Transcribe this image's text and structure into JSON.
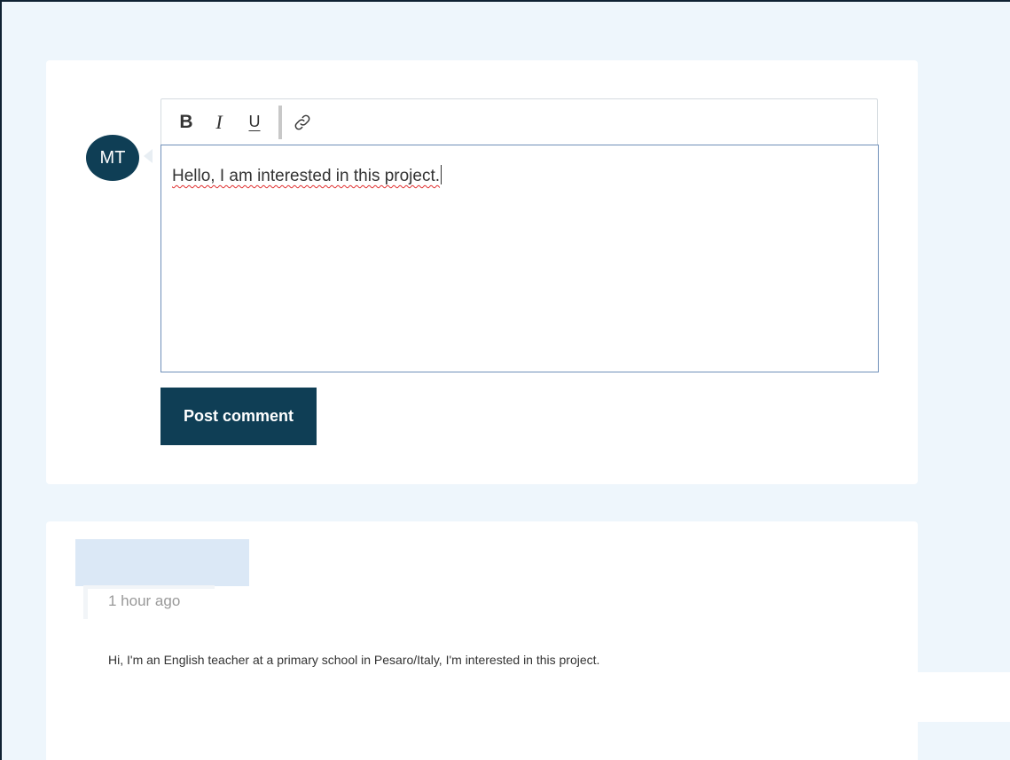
{
  "composer": {
    "avatar_initials": "MT",
    "toolbar": {
      "bold": "B",
      "italic": "I",
      "underline": "U",
      "link_icon": "link-icon"
    },
    "text_value": "Hello, I am interested in this project.",
    "post_label": "Post comment"
  },
  "comment": {
    "timestamp": "1 hour ago",
    "text": "Hi, I'm an English teacher at a primary school in Pesaro/Italy, I'm interested in this project."
  },
  "colors": {
    "background": "#eef6fc",
    "accent": "#0f3e55",
    "name_placeholder": "#dbe8f6",
    "spellcheck": "#e03030"
  }
}
